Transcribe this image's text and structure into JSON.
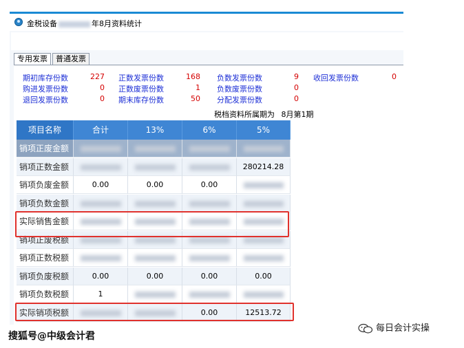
{
  "window": {
    "title_prefix": "金税设备",
    "title_suffix": "年8月资料统计"
  },
  "tabs": [
    {
      "label": "专用发票",
      "active": true
    },
    {
      "label": "普通发票",
      "active": false
    }
  ],
  "stats": [
    {
      "label": "期初库存份数",
      "value": "227"
    },
    {
      "label": "正数发票份数",
      "value": "168"
    },
    {
      "label": "负数发票份数",
      "value": "9"
    },
    {
      "label": "收回发票份数",
      "value": "0"
    },
    {
      "label": "购进发票份数",
      "value": "0"
    },
    {
      "label": "正数废票份数",
      "value": "1"
    },
    {
      "label": "负数废票份数",
      "value": "0"
    },
    {
      "label": "退回发票份数",
      "value": "0"
    },
    {
      "label": "期末库存份数",
      "value": "50"
    },
    {
      "label": "分配发票份数",
      "value": "0"
    }
  ],
  "period": {
    "label": "税档资料所属期为",
    "value": "8月第1期"
  },
  "table": {
    "headers": [
      "项目名称",
      "合计",
      "13%",
      "6%",
      "5%"
    ],
    "rows": [
      {
        "name": "销项正废金额",
        "cells": [
          "",
          "",
          "",
          ""
        ]
      },
      {
        "name": "销项正数金额",
        "cells": [
          "",
          "",
          "",
          "280214.28"
        ]
      },
      {
        "name": "销项负废金额",
        "cells": [
          "0.00",
          "0.00",
          "0.00",
          ""
        ]
      },
      {
        "name": "销项负数金额",
        "cells": [
          "",
          "",
          "",
          ""
        ]
      },
      {
        "name": "实际销售金额",
        "cells": [
          "",
          "",
          "",
          ""
        ]
      },
      {
        "name": "销项正废税额",
        "cells": [
          "",
          "",
          "",
          ""
        ]
      },
      {
        "name": "销项正数税额",
        "cells": [
          "",
          "",
          "",
          ""
        ]
      },
      {
        "name": "销项负废税额",
        "cells": [
          "0.00",
          "0.00",
          "0.00",
          "0.00"
        ]
      },
      {
        "name": "销项负数税额",
        "cells": [
          "1",
          "",
          "",
          ""
        ]
      },
      {
        "name": "实际销项税额",
        "cells": [
          "",
          "",
          "0.00",
          "12513.72"
        ]
      }
    ]
  },
  "watermark_left": "搜狐号@中级会计君",
  "watermark_right": "每日会计实操",
  "colors": {
    "header_blue": "#3f86d4",
    "stat_label": "#1d2fd6",
    "stat_value": "#d40000",
    "highlight_border": "#e0312c"
  }
}
